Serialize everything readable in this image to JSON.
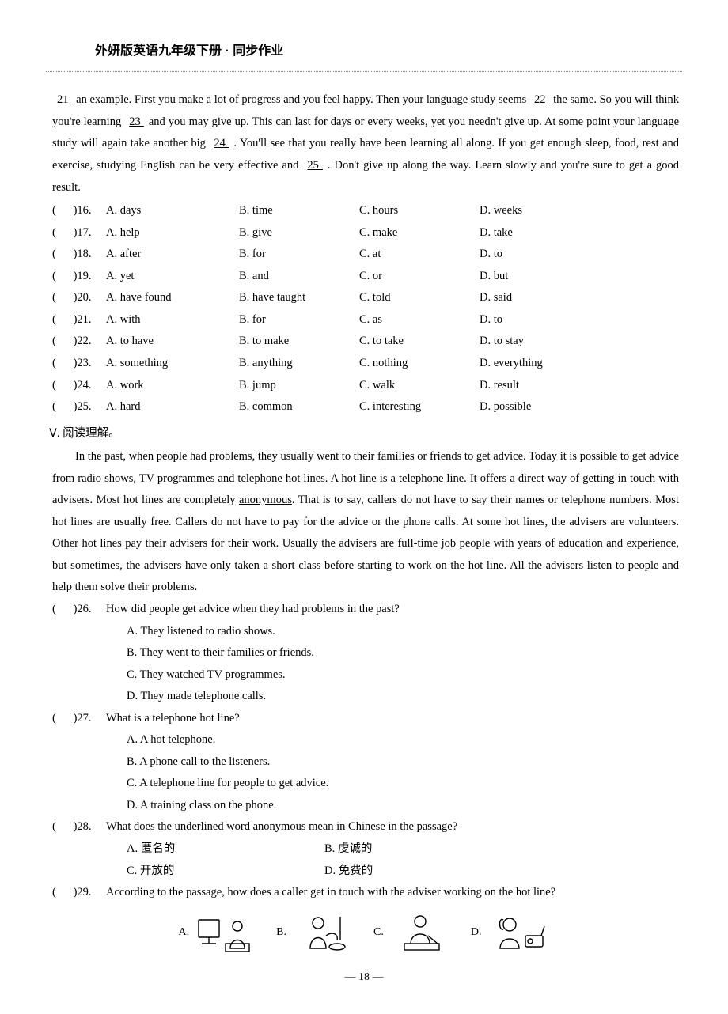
{
  "header": {
    "title": "外妍版英语九年级下册 · 同步作业"
  },
  "passage": {
    "text_parts": [
      "  21  ",
      " an example. First you make a lot of progress and you feel happy. Then your language study seems ",
      "  22  ",
      " the same. So you will think you're learning ",
      "  23  ",
      " and you may give up. This can last for days or every weeks, yet you needn't give up. At some point your language study will again take another big ",
      "  24  ",
      ". You'll see that you really have been learning all along. If you get enough sleep, food, rest and exercise, studying English can be very effective and ",
      "  25  ",
      ". Don't give up along the way. Learn slowly and you're sure to get a good result."
    ]
  },
  "cloze_options": [
    {
      "num": "16",
      "a": "A. days",
      "b": "B. time",
      "c": "C. hours",
      "d": "D. weeks"
    },
    {
      "num": "17",
      "a": "A. help",
      "b": "B. give",
      "c": "C. make",
      "d": "D. take"
    },
    {
      "num": "18",
      "a": "A. after",
      "b": "B. for",
      "c": "C. at",
      "d": "D. to"
    },
    {
      "num": "19",
      "a": "A. yet",
      "b": "B. and",
      "c": "C. or",
      "d": "D. but"
    },
    {
      "num": "20",
      "a": "A. have found",
      "b": "B. have taught",
      "c": "C. told",
      "d": "D. said"
    },
    {
      "num": "21",
      "a": "A. with",
      "b": "B. for",
      "c": "C. as",
      "d": "D. to"
    },
    {
      "num": "22",
      "a": "A. to have",
      "b": "B. to make",
      "c": "C. to take",
      "d": "D. to stay"
    },
    {
      "num": "23",
      "a": "A. something",
      "b": "B. anything",
      "c": "C. nothing",
      "d": "D. everything"
    },
    {
      "num": "24",
      "a": "A. work",
      "b": "B. jump",
      "c": "C. walk",
      "d": "D. result"
    },
    {
      "num": "25",
      "a": "A. hard",
      "b": "B. common",
      "c": "C. interesting",
      "d": "D. possible"
    }
  ],
  "section5": {
    "title": "Ⅴ. 阅读理解。",
    "paragraph": "In the past, when people had problems, they usually went to their families or friends to get advice. Today it is possible to get advice from radio shows, TV programmes and telephone hot lines. A hot line is a telephone line. It offers a direct way of getting in touch with advisers. Most hot lines are completely ",
    "underlined": "anonymous",
    "paragraph_after": ". That is to say, callers do not have to say their names or telephone numbers. Most hot lines are usually free. Callers do not have to pay for the advice or the phone calls. At some hot lines, the advisers are volunteers. Other hot lines pay their advisers for their work. Usually the advisers are full-time job people with years of education and experience, but sometimes, the advisers have only taken a short class before starting to work on the hot line. All the advisers listen to people and help them solve their problems."
  },
  "questions": [
    {
      "num": "26",
      "stem": "How did people get advice when they had problems in the past?",
      "choices": [
        "A. They listened to radio shows.",
        "B. They went to their families or friends.",
        "C. They watched TV programmes.",
        "D. They made telephone calls."
      ]
    },
    {
      "num": "27",
      "stem": "What is a telephone hot line?",
      "choices": [
        "A. A hot telephone.",
        "B. A phone call to the listeners.",
        "C. A telephone line for people to get advice.",
        "D. A training class on the phone."
      ]
    },
    {
      "num": "28",
      "stem": "What does the underlined word anonymous mean in Chinese in the passage?",
      "two_col": [
        {
          "a": "A. 匿名的",
          "b": "B. 虔诚的"
        },
        {
          "a": "C. 开放的",
          "b": "D. 免费的"
        }
      ]
    },
    {
      "num": "29",
      "stem": "According to the passage, how does a caller get in touch with the adviser working on the hot line?"
    }
  ],
  "image_labels": {
    "a": "A.",
    "b": "B.",
    "c": "C.",
    "d": "D."
  },
  "page_number": "— 18 —",
  "paren_open": "(",
  "paren_close": ")"
}
